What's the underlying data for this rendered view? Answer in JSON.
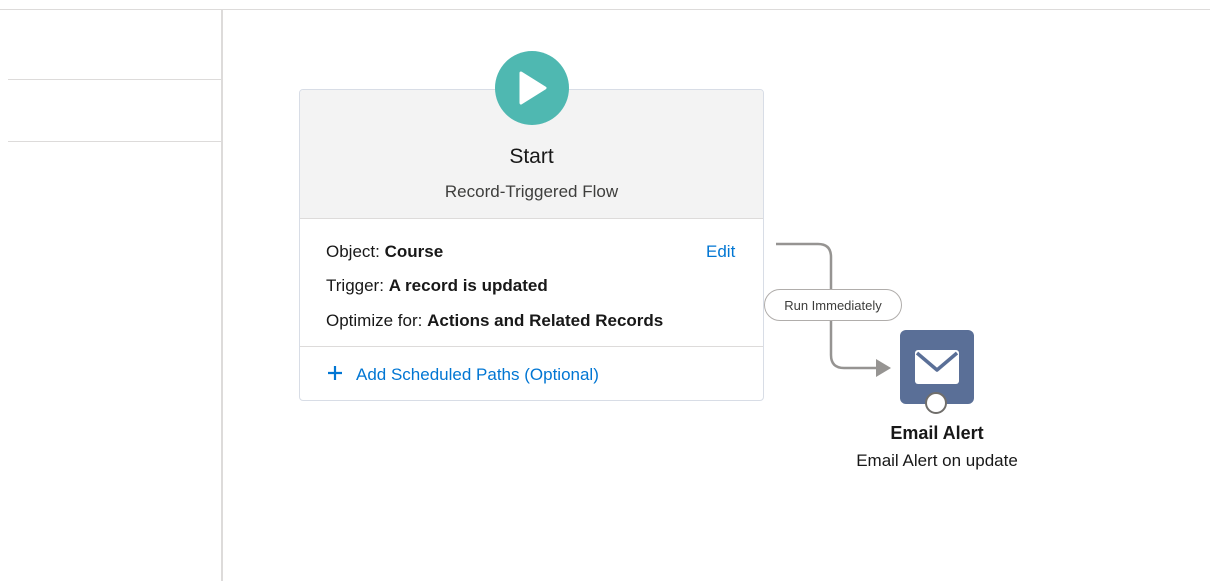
{
  "start_node": {
    "title": "Start",
    "subtitle": "Record-Triggered Flow",
    "object_label": "Object:",
    "object_value": "Course",
    "trigger_label": "Trigger:",
    "trigger_value": "A record is updated",
    "optimize_label": "Optimize for:",
    "optimize_value": "Actions and Related Records",
    "edit_label": "Edit",
    "add_paths_label": "Add Scheduled Paths (Optional)",
    "icon": "play-icon",
    "icon_color": "#4fb8b1"
  },
  "connector": {
    "label": "Run Immediately"
  },
  "email_node": {
    "title": "Email Alert",
    "subtitle": "Email Alert on update",
    "icon": "envelope-icon",
    "icon_color": "#5a6f97"
  },
  "colors": {
    "link": "#0176d3",
    "border": "#dddbda"
  }
}
